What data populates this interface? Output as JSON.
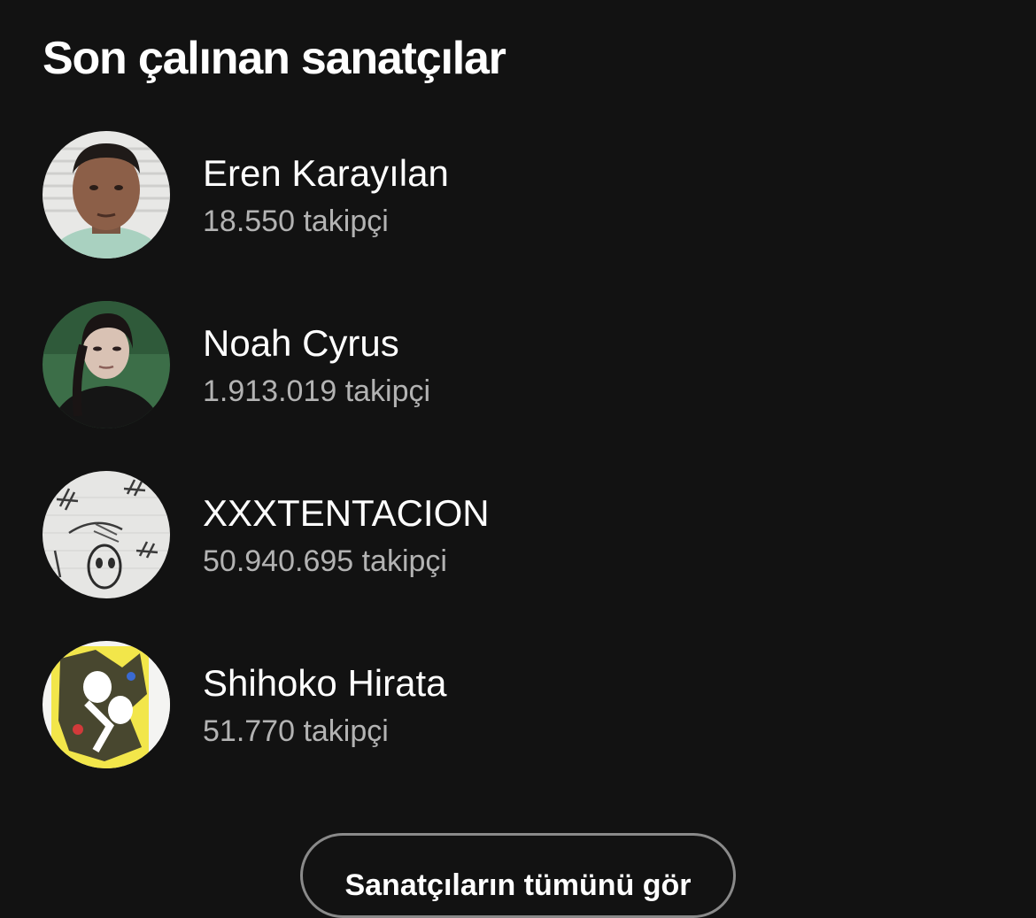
{
  "section": {
    "title": "Son çalınan sanatçılar"
  },
  "artists": [
    {
      "name": "Eren Karayılan",
      "followers": "18.550 takipçi",
      "avatar": "artist-photo"
    },
    {
      "name": "Noah Cyrus",
      "followers": "1.913.019 takipçi",
      "avatar": "artist-photo"
    },
    {
      "name": "XXXTENTACION",
      "followers": "50.940.695 takipçi",
      "avatar": "sketch-artwork"
    },
    {
      "name": "Shihoko Hirata",
      "followers": "51.770 takipçi",
      "avatar": "anime-artwork"
    }
  ],
  "see_all_button": {
    "label": "Sanatçıların tümünü gör"
  },
  "colors": {
    "background": "#121212",
    "primary_text": "#ffffff",
    "secondary_text": "#b3b3b3",
    "button_border": "#8a8a8a"
  }
}
